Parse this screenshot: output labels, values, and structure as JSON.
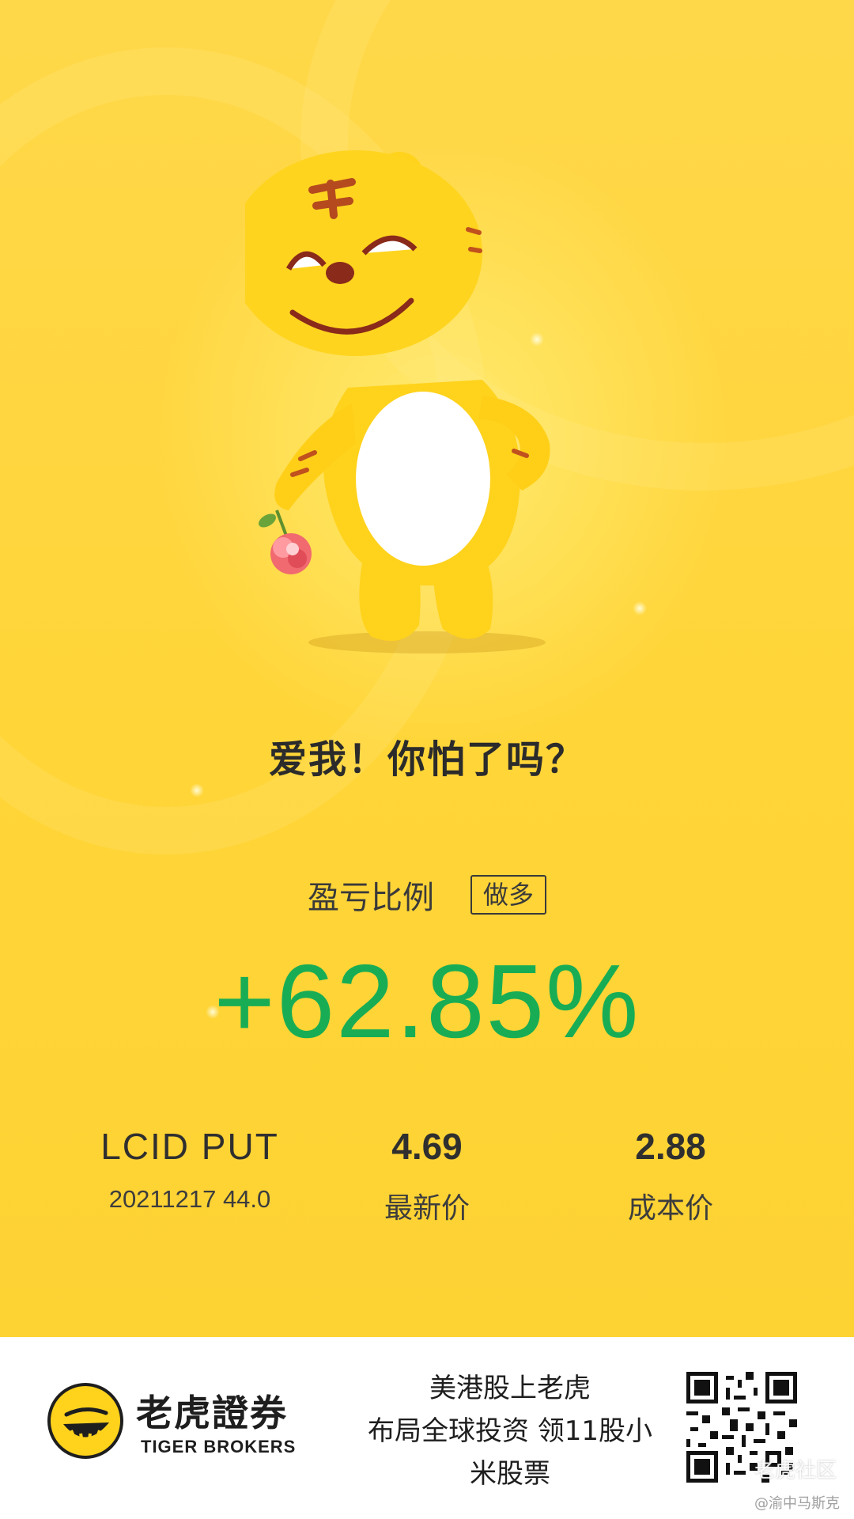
{
  "tagline": "爱我！你怕了吗？",
  "ratio": {
    "label": "盈亏比例",
    "direction": "做多",
    "value": "+62.85%"
  },
  "position": {
    "symbol": "LCID  PUT",
    "contract": "20211217 44.0"
  },
  "latest_price": {
    "value": "4.69",
    "label": "最新价"
  },
  "cost_price": {
    "value": "2.88",
    "label": "成本价"
  },
  "footer": {
    "brand_cn": "老虎證券",
    "brand_en": "TIGER BROKERS",
    "promo_line1": "美港股上老虎",
    "promo_line2": "布局全球投资 领11股小",
    "promo_line3": "米股票",
    "watermark": "老虎社区",
    "credit": "@渝中马斯克"
  },
  "colors": {
    "background": "#ffd538",
    "profit": "#18ad55",
    "text": "#2b2b2b"
  },
  "icons": [
    "tiger-mascot-illustration",
    "tiger-brokers-logo-icon",
    "qr-code-icon"
  ]
}
